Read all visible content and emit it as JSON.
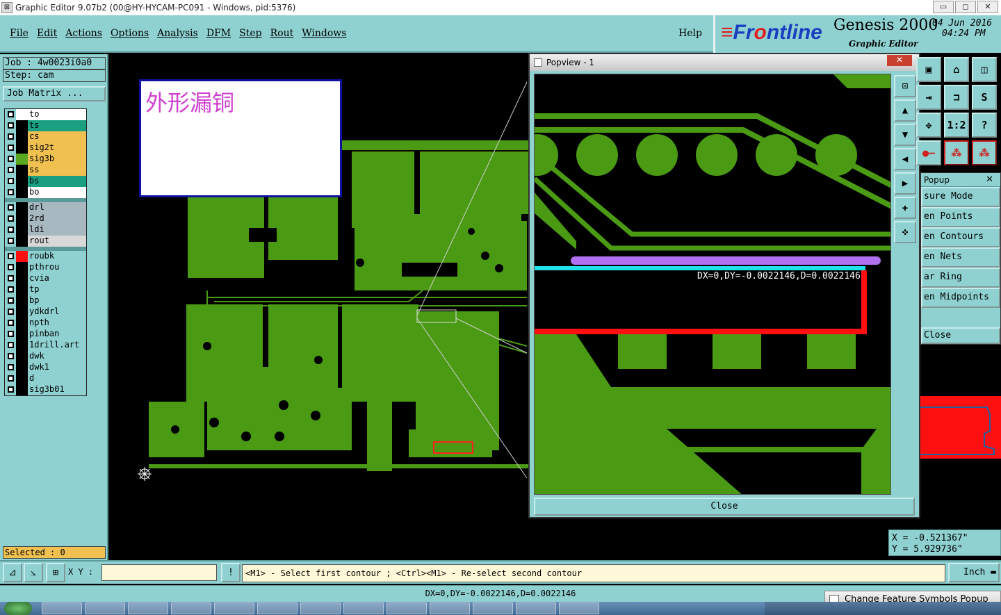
{
  "window": {
    "title": "Graphic Editor 9.07b2 (00@HY-HYCAM-PC091 - Windows, pid:5376)",
    "min": "▭",
    "max": "◻",
    "close": "✕"
  },
  "menu": {
    "items": [
      "File",
      "Edit",
      "Actions",
      "Options",
      "Analysis",
      "DFM",
      "Step",
      "Rout",
      "Windows"
    ],
    "help": "Help"
  },
  "brand": {
    "logo_prefix": "Fr",
    "logo_rest": "ntline",
    "logo_o": "o",
    "product": "Genesis 2000",
    "subtitle": "Graphic Editor",
    "date": "04 Jun 2016",
    "time": "04:24 PM"
  },
  "job": {
    "job": "Job  : 4w0023i0a0",
    "step": "Step: cam",
    "matrix_button": "Job Matrix ..."
  },
  "layers": {
    "group1": [
      {
        "name": "to",
        "color": "#ffffff",
        "dot": "#ffffff"
      },
      {
        "name": "ts",
        "color": "#1aa080",
        "dot": "#000000"
      },
      {
        "name": "cs",
        "color": "#f0c050",
        "dot": "#000000"
      },
      {
        "name": "sig2t",
        "color": "#f0c050",
        "dot": "#000000"
      },
      {
        "name": "sig3b",
        "color": "#f0c050",
        "dot": "#5aa820"
      },
      {
        "name": "ss",
        "color": "#f0c050",
        "dot": "#000000"
      },
      {
        "name": "bs",
        "color": "#1aa080",
        "dot": "#000000"
      },
      {
        "name": "bo",
        "color": "#ffffff",
        "dot": "#000000"
      }
    ],
    "group2": [
      {
        "name": "drl",
        "color": "#a8b8c0",
        "dot": "#000000"
      },
      {
        "name": "2rd",
        "color": "#a8b8c0",
        "dot": "#000000"
      },
      {
        "name": "ldi",
        "color": "#a8b8c0",
        "dot": "#000000"
      },
      {
        "name": "rout",
        "color": "#d8d8d8",
        "dot": "#000000"
      }
    ],
    "group3": [
      {
        "name": "roubk",
        "color": "#8fd1d1",
        "dot": "#ff1010"
      },
      {
        "name": "pthrou",
        "color": "#8fd1d1",
        "dot": "#000000"
      },
      {
        "name": "cvia",
        "color": "#8fd1d1",
        "dot": "#000000"
      },
      {
        "name": "tp",
        "color": "#8fd1d1",
        "dot": "#000000"
      },
      {
        "name": "bp",
        "color": "#8fd1d1",
        "dot": "#000000"
      },
      {
        "name": "ydkdrl",
        "color": "#8fd1d1",
        "dot": "#000000"
      },
      {
        "name": "npth",
        "color": "#8fd1d1",
        "dot": "#000000"
      },
      {
        "name": "pinban",
        "color": "#8fd1d1",
        "dot": "#000000"
      },
      {
        "name": "1drill.art",
        "color": "#8fd1d1",
        "dot": "#000000"
      },
      {
        "name": "dwk",
        "color": "#8fd1d1",
        "dot": "#000000"
      },
      {
        "name": "dwk1",
        "color": "#8fd1d1",
        "dot": "#000000"
      },
      {
        "name": "d",
        "color": "#8fd1d1",
        "dot": "#000000"
      },
      {
        "name": "sig3b01",
        "color": "#8fd1d1",
        "dot": "#000000"
      }
    ],
    "selected": "Selected : 0"
  },
  "note": {
    "text": "外形漏铜"
  },
  "popview": {
    "title": "Popview - 1",
    "measure": "DX=0,DY=-0.0022146,D=0.0022146",
    "close": "Close"
  },
  "popup": {
    "title": "Popup",
    "items": [
      "sure Mode",
      "en Points",
      "en Contours",
      "en Nets",
      "ar Ring",
      "en Midpoints"
    ],
    "close": "Close"
  },
  "coords": {
    "x": "X  = -0.521367\"",
    "y": "Y  = 5.929736\""
  },
  "command": {
    "xy_label": "X Y :",
    "xy_value": "",
    "prompt": "<M1> - Select first contour ; <Ctrl><M1> - Re-select second contour",
    "unit": "Inch"
  },
  "status": {
    "text": "DX=0,DY=-0.0022146,D=0.0022146"
  },
  "bottom_popup": "Change Feature Symbols Popup",
  "colors": {
    "copper": "#4a9a14",
    "panel": "#8fd1d1",
    "measure_cyan": "#20e0e8",
    "measure_purple": "#b070f0",
    "contour_red": "#ff1010"
  }
}
